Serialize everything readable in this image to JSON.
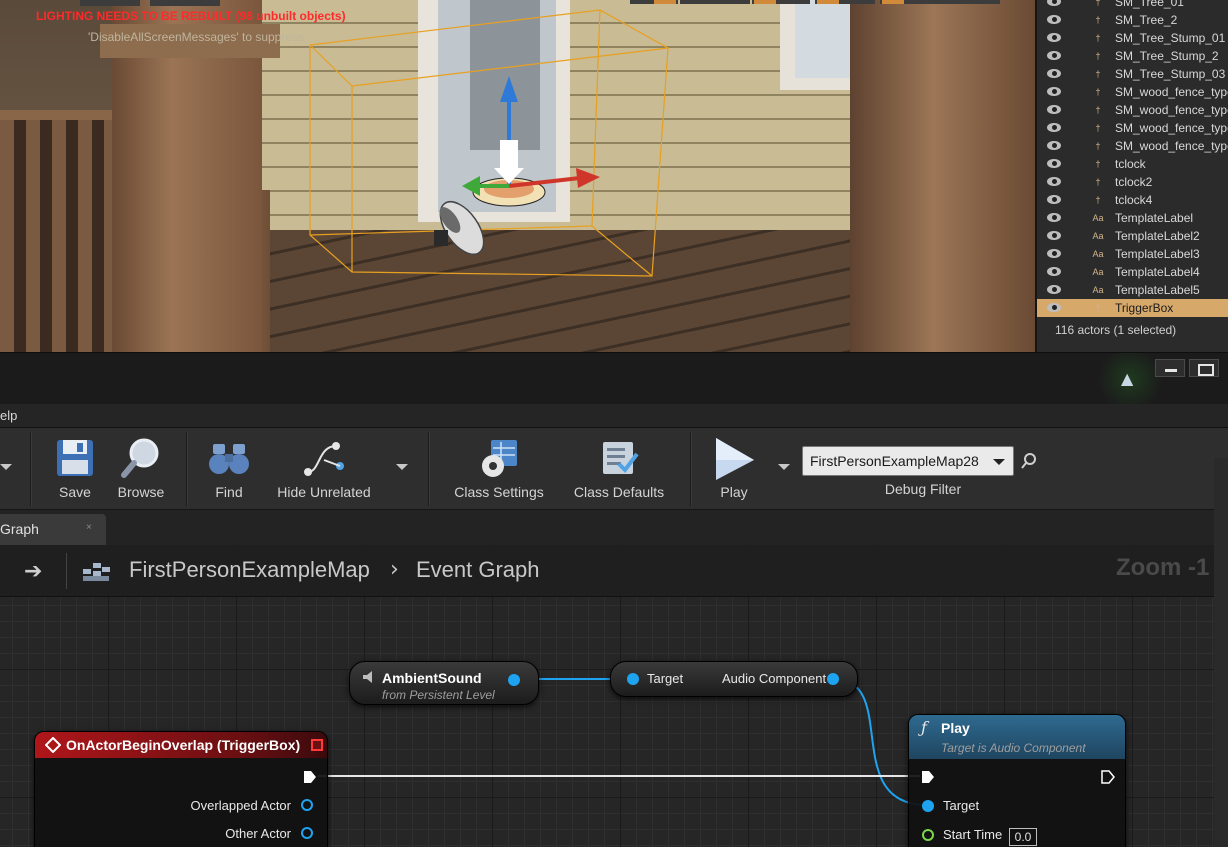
{
  "viewport": {
    "warning": "LIGHTING NEEDS TO BE REBUILT (98 unbuilt objects)",
    "suppress_hint": "'DisableAllScreenMessages' to suppress"
  },
  "outliner": {
    "items": [
      {
        "label": "SM_Tree_01",
        "icon": "static-mesh-icon",
        "selected": false
      },
      {
        "label": "SM_Tree_2",
        "icon": "static-mesh-icon",
        "selected": false
      },
      {
        "label": "SM_Tree_Stump_01",
        "icon": "static-mesh-icon",
        "selected": false
      },
      {
        "label": "SM_Tree_Stump_2",
        "icon": "static-mesh-icon",
        "selected": false
      },
      {
        "label": "SM_Tree_Stump_03",
        "icon": "static-mesh-icon",
        "selected": false
      },
      {
        "label": "SM_wood_fence_type",
        "icon": "static-mesh-icon",
        "selected": false
      },
      {
        "label": "SM_wood_fence_type",
        "icon": "static-mesh-icon",
        "selected": false
      },
      {
        "label": "SM_wood_fence_type",
        "icon": "static-mesh-icon",
        "selected": false
      },
      {
        "label": "SM_wood_fence_type",
        "icon": "static-mesh-icon",
        "selected": false
      },
      {
        "label": "tclock",
        "icon": "static-mesh-icon",
        "selected": false
      },
      {
        "label": "tclock2",
        "icon": "static-mesh-icon",
        "selected": false
      },
      {
        "label": "tclock4",
        "icon": "static-mesh-icon",
        "selected": false
      },
      {
        "label": "TemplateLabel",
        "icon": "text-render-icon",
        "selected": false
      },
      {
        "label": "TemplateLabel2",
        "icon": "text-render-icon",
        "selected": false
      },
      {
        "label": "TemplateLabel3",
        "icon": "text-render-icon",
        "selected": false
      },
      {
        "label": "TemplateLabel4",
        "icon": "text-render-icon",
        "selected": false
      },
      {
        "label": "TemplateLabel5",
        "icon": "text-render-icon",
        "selected": false
      },
      {
        "label": "TriggerBox",
        "icon": "trigger-box-icon",
        "selected": true
      }
    ],
    "text_icon_glyph": "Aa",
    "footer": "116 actors (1 selected)"
  },
  "menubar": {
    "label": "elp"
  },
  "toolbar": {
    "save": "Save",
    "browse": "Browse",
    "find": "Find",
    "hide_unrelated": "Hide Unrelated",
    "class_settings": "Class Settings",
    "class_defaults": "Class Defaults",
    "play": "Play",
    "debug_object": "FirstPersonExampleMap28",
    "debug_filter": "Debug Filter"
  },
  "tab": {
    "label": "Graph",
    "close": "×"
  },
  "breadcrumb": {
    "map": "FirstPersonExampleMap",
    "separator": "›",
    "graph": "Event Graph",
    "zoom": "Zoom -1"
  },
  "nodes": {
    "ambient_sound": {
      "title": "AmbientSound",
      "subtitle": "from Persistent Level"
    },
    "get_audio": {
      "target": "Target",
      "output": "Audio Component"
    },
    "event": {
      "title": "OnActorBeginOverlap (TriggerBox)",
      "pins": [
        "Overlapped Actor",
        "Other Actor"
      ]
    },
    "play": {
      "title": "Play",
      "subtitle": "Target is Audio Component",
      "pins": [
        "Target",
        "Start Time"
      ],
      "start_time_value": "0.0"
    }
  },
  "colors": {
    "object_pin": "#1ea3f0",
    "float_pin": "#7cd94a",
    "event_header": "#b0161a",
    "function_header": "#2b5a7a",
    "selection": "#d6a96b",
    "warning": "#ff2a2a"
  }
}
